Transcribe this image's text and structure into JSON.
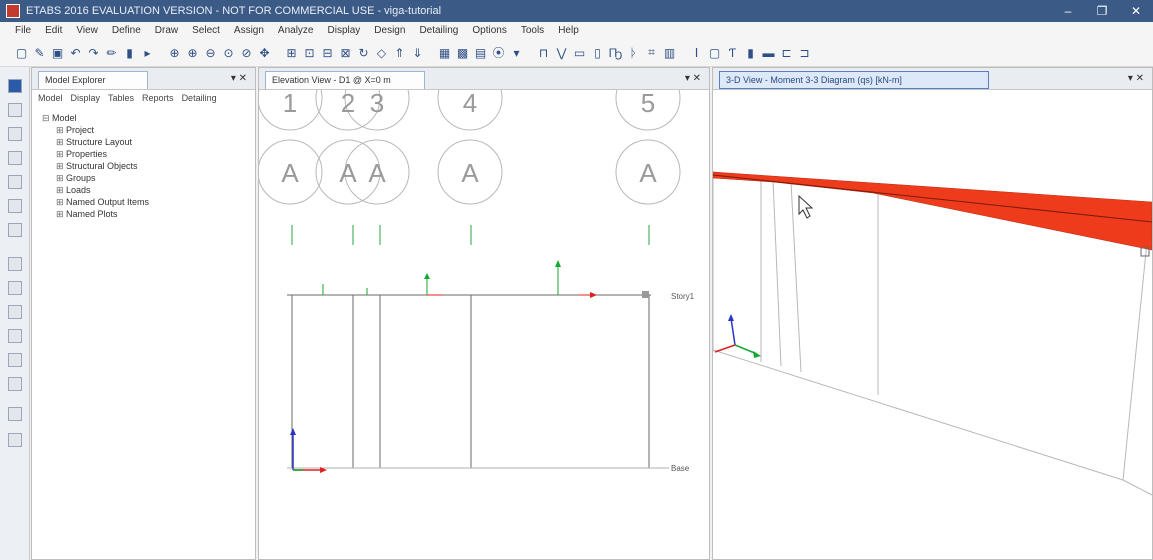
{
  "window": {
    "title": "ETABS 2016 EVALUATION VERSION - NOT FOR COMMERCIAL USE - viga-tutorial",
    "minimize": "–",
    "restore": "❐",
    "close": "✕"
  },
  "menu": [
    "File",
    "Edit",
    "View",
    "Define",
    "Draw",
    "Select",
    "Assign",
    "Analyze",
    "Display",
    "Design",
    "Detailing",
    "Options",
    "Tools",
    "Help"
  ],
  "model_explorer": {
    "title": "Model Explorer",
    "controls": "▾ ✕",
    "subtabs": [
      "Model",
      "Display",
      "Tables",
      "Reports",
      "Detailing"
    ],
    "tree_root": "Model",
    "tree_items": [
      "Project",
      "Structure Layout",
      "Properties",
      "Structural Objects",
      "Groups",
      "Loads",
      "Named Output Items",
      "Named Plots"
    ]
  },
  "elevation_view": {
    "title": "Elevation View - D1 @ X=0 m",
    "controls": "▾ ✕",
    "grid_numbers": [
      "1",
      "2",
      "3",
      "4",
      "5"
    ],
    "grid_letters": [
      "A",
      "A",
      "A",
      "A",
      "A"
    ],
    "story_top": "Story1",
    "story_base": "Base"
  },
  "view_3d": {
    "title": "3-D View - Moment 3-3 Diagram (qs) [kN-m]",
    "controls": "▾ ✕",
    "diagram_color": "#ee3b1c"
  },
  "colors": {
    "titlebar": "#3c5a86",
    "axis_red": "#e02020",
    "axis_green": "#16a830",
    "axis_blue": "#2a35c8"
  }
}
